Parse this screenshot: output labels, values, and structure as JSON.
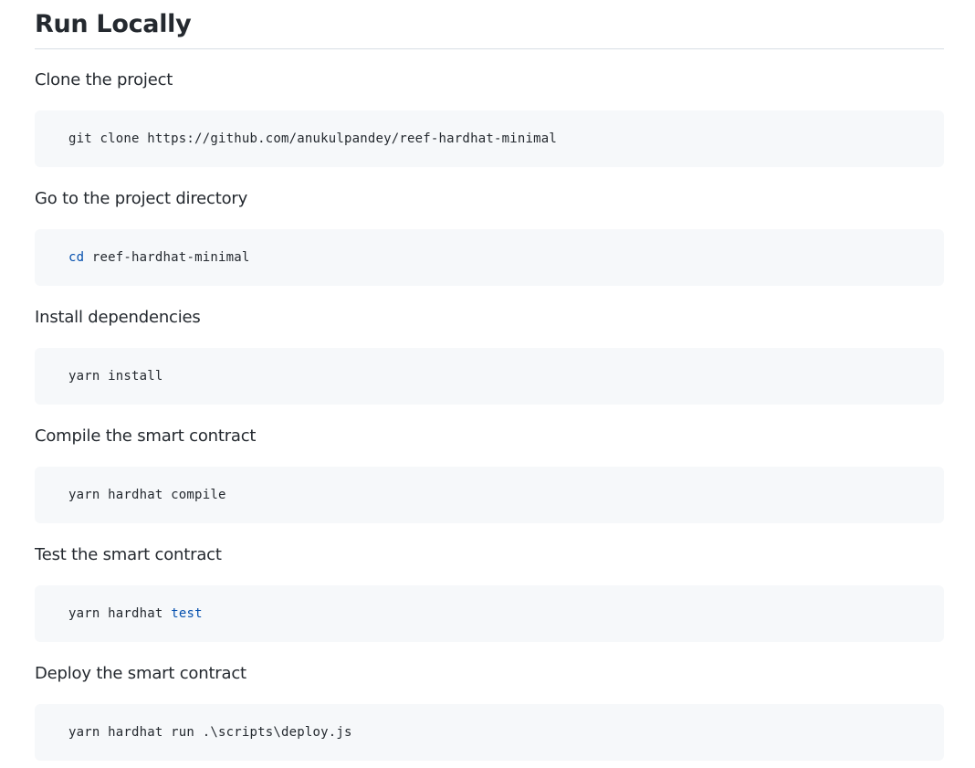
{
  "section": {
    "title": "Run Locally"
  },
  "steps": [
    {
      "label": "Clone the project",
      "code": {
        "cmd": "",
        "rest": "git clone https://github.com/anukulpandey/reef-hardhat-minimal",
        "tail": ""
      }
    },
    {
      "label": "Go to the project directory",
      "code": {
        "cmd": "cd",
        "rest": " reef-hardhat-minimal",
        "tail": ""
      }
    },
    {
      "label": "Install dependencies",
      "code": {
        "cmd": "",
        "rest": "yarn install",
        "tail": ""
      }
    },
    {
      "label": "Compile the smart contract",
      "code": {
        "cmd": "",
        "rest": "yarn hardhat compile",
        "tail": ""
      }
    },
    {
      "label": "Test the smart contract",
      "code": {
        "cmd": "",
        "rest": "yarn hardhat ",
        "tail": "test"
      }
    },
    {
      "label": "Deploy the smart contract",
      "code": {
        "cmd": "",
        "rest": "yarn hardhat run .\\scripts\\deploy.js",
        "tail": ""
      }
    }
  ],
  "colors": {
    "text": "#24292f",
    "code_background": "#f6f8fa",
    "keyword": "#0550ae",
    "divider": "#d8dee4"
  }
}
